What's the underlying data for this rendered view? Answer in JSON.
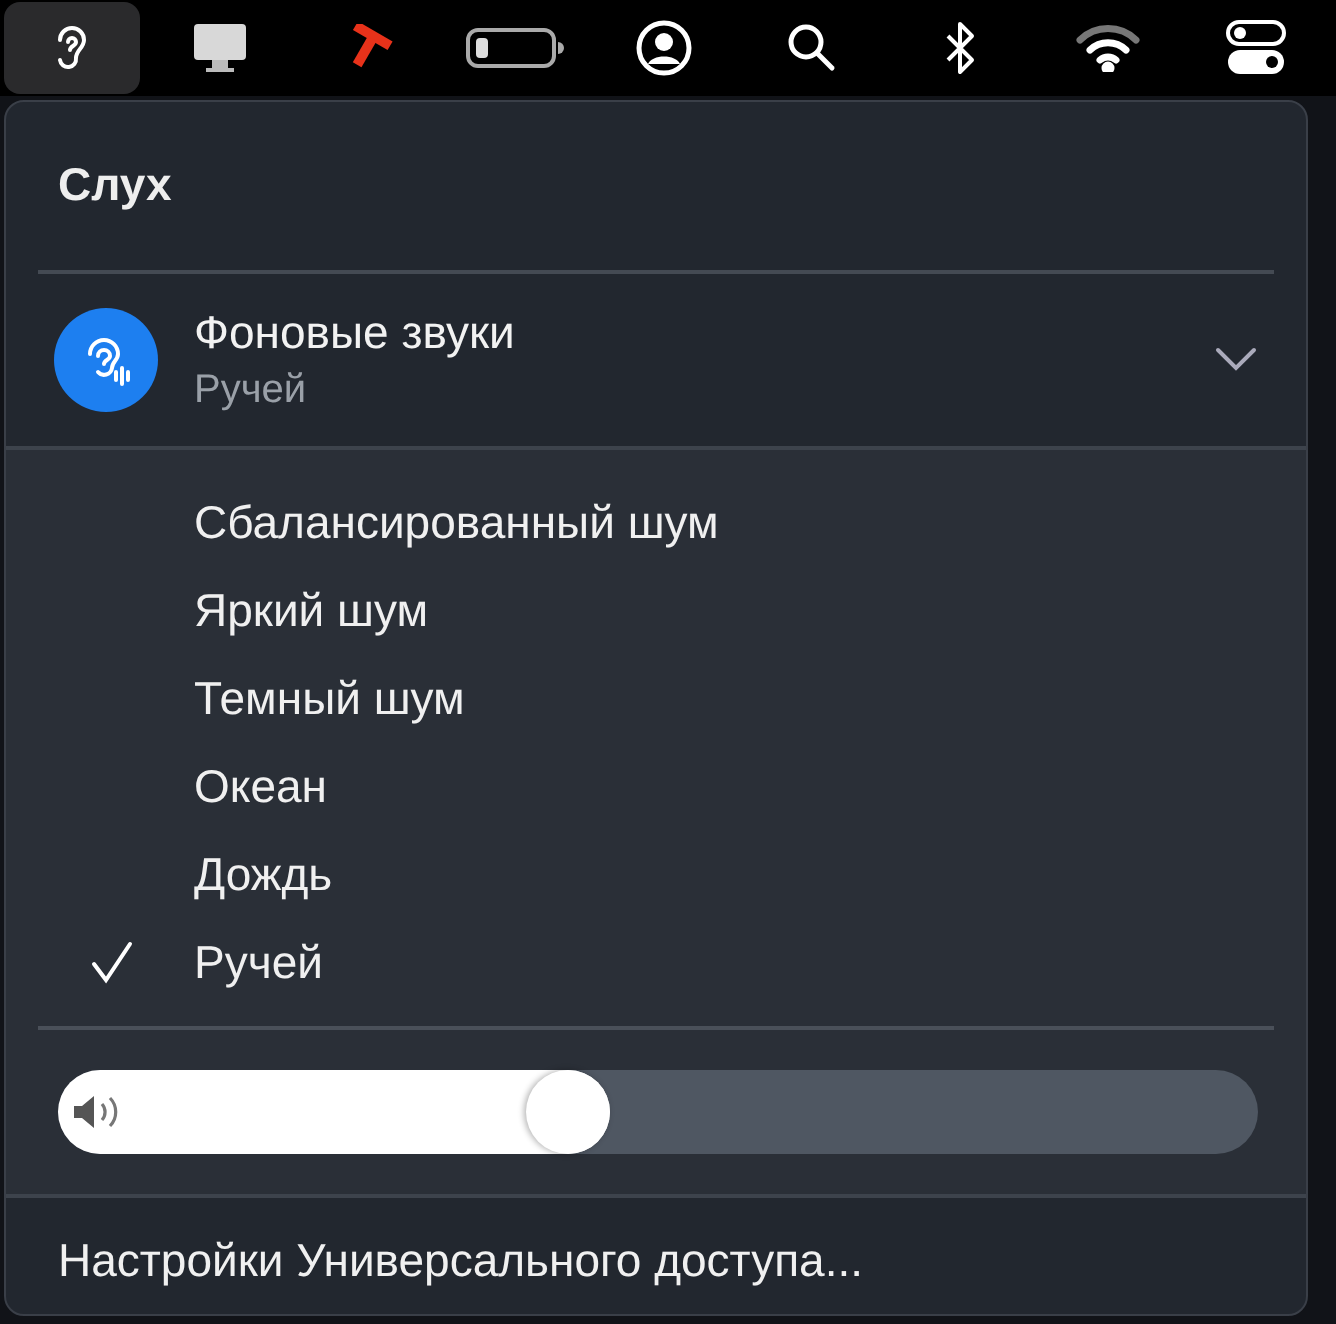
{
  "menu_bar": [
    {
      "kind": "ear",
      "selected": true
    },
    {
      "kind": "display",
      "selected": false
    },
    {
      "kind": "tool",
      "selected": false
    },
    {
      "kind": "battery",
      "selected": false
    },
    {
      "kind": "user",
      "selected": false
    },
    {
      "kind": "search",
      "selected": false
    },
    {
      "kind": "bluetooth",
      "selected": false
    },
    {
      "kind": "wifi",
      "selected": false
    },
    {
      "kind": "controls",
      "selected": false
    }
  ],
  "panel": {
    "title": "Слух",
    "background_sounds": {
      "title": "Фоновые звуки",
      "subtitle": "Ручей",
      "expanded": true,
      "options": [
        {
          "label": "Сбалансированный шум",
          "selected": false
        },
        {
          "label": "Яркий шум",
          "selected": false
        },
        {
          "label": "Темный шум",
          "selected": false
        },
        {
          "label": "Океан",
          "selected": false
        },
        {
          "label": "Дождь",
          "selected": false
        },
        {
          "label": "Ручей",
          "selected": true
        }
      ]
    },
    "volume": {
      "level": 0.46
    },
    "footer_link": "Настройки Универсального доступа..."
  }
}
